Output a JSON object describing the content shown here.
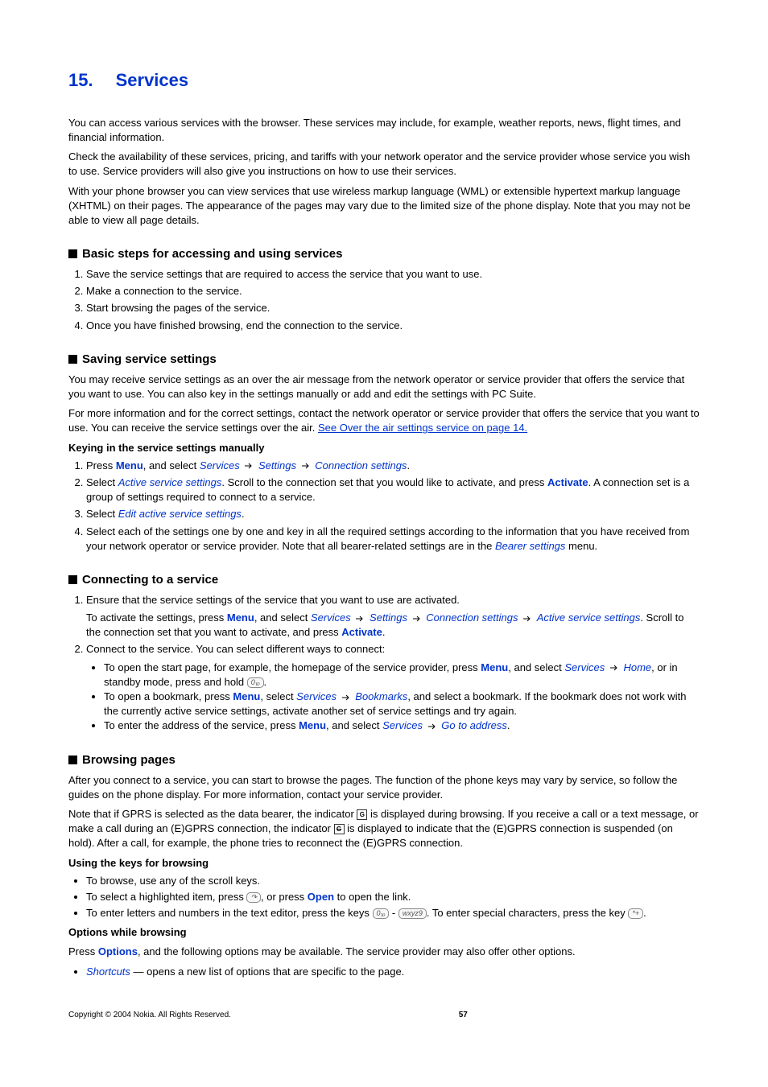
{
  "chapter": {
    "num": "15.",
    "title": "Services"
  },
  "intro": {
    "p1": "You can access various services with the browser. These services may include, for example, weather reports, news, flight times, and financial information.",
    "p2": "Check the availability of these services, pricing, and tariffs with your network operator and the service provider whose service you wish to use. Service providers will also give you instructions on how to use their services.",
    "p3": "With your phone browser you can view services that use wireless markup language (WML) or extensible hypertext markup language (XHTML) on their pages. The appearance of the pages may vary due to the limited size of the phone display. Note that you may not be able to view all page details."
  },
  "s1": {
    "title": "Basic steps for accessing and using services",
    "i1": "Save the service settings that are required to access the service that you want to use.",
    "i2": "Make a connection to the service.",
    "i3": "Start browsing the pages of the service.",
    "i4": "Once you have finished browsing, end the connection to the service."
  },
  "s2": {
    "title": "Saving service settings",
    "p1": "You may receive service settings as an over the air message from the network operator or service provider that offers the service that you want to use. You can also key in the settings manually or add and edit the settings with PC Suite.",
    "p2a": "For more information and for the correct settings, contact the network operator or service provider that offers the service that you want to use. You can receive the service settings over the air. ",
    "p2link": "See Over the air settings service on page 14.",
    "sub": "Keying in the service settings manually",
    "press": "Press ",
    "menu": "Menu",
    "andselect": ", and select ",
    "services": "Services",
    "settings": "Settings",
    "connsettings": "Connection settings",
    "dot": ".",
    "i2a": "Select ",
    "activeserv": "Active service settings",
    "i2b": ". Scroll to the connection set that you would like to activate, and press ",
    "activate": "Activate",
    "i2c": ". A connection set is a group of settings required to connect to a service.",
    "i3a": "Select ",
    "editactive": "Edit active service settings",
    "i4a": "Select each of the settings one by one and key in all the required settings according to the information that you have received from your network operator or service provider. Note that all bearer-related settings are in the ",
    "bearer": "Bearer settings",
    "i4b": " menu."
  },
  "s3": {
    "title": "Connecting to a service",
    "i1": "Ensure that the service settings of the service that you want to use are activated.",
    "i1ba": "To activate the settings, press ",
    "i1bb": ". Scroll to the connection set that you want to activate, and press ",
    "i1bc": ".",
    "i2": "Connect to the service. You can select different ways to connect:",
    "b1a": "To open the start page, for example, the homepage of the service provider, press ",
    "home": "Home",
    "b1b": ", or in standby mode, press and hold ",
    "b2a": "To open a bookmark, press ",
    "select": ", select ",
    "bookmarks": "Bookmarks",
    "b2b": ", and select a bookmark. If the bookmark does not work with the currently active service settings, activate another set of service settings and try again.",
    "b3a": "To enter the address of the service, press ",
    "gotoaddr": "Go to address"
  },
  "s4": {
    "title": "Browsing pages",
    "p1": "After you connect to a service, you can start to browse the pages. The function of the phone keys may vary by service, so follow the guides on the phone display. For more information, contact your service provider.",
    "p2a": "Note that if GPRS is selected as the data bearer, the indicator ",
    "p2b": " is displayed during browsing. If you receive a call or a text message, or make a call during an (E)GPRS connection, the indicator ",
    "p2c": " is displayed to indicate that the (E)GPRS connection is suspended (on hold). After a call, for example, the phone tries to reconnect the (E)GPRS connection.",
    "sub1": "Using the keys for browsing",
    "b1": "To browse, use any of the scroll keys.",
    "b2a": "To select a highlighted item, press ",
    "b2b": ", or press ",
    "open": "Open",
    "b2c": " to open the link.",
    "b3a": "To enter letters and numbers in the text editor, press the keys ",
    "b3dash": " - ",
    "b3b": ". To enter special characters, press the key ",
    "sub2": "Options while browsing",
    "p3a": "Press ",
    "options": "Options",
    "p3b": ", and the following options may be available. The service provider may also offer other options.",
    "shortcuts": "Shortcuts",
    "b4": " — opens a new list of options that are specific to the page."
  },
  "footer": {
    "copyright": "Copyright © 2004 Nokia. All Rights Reserved.",
    "page": "57"
  }
}
